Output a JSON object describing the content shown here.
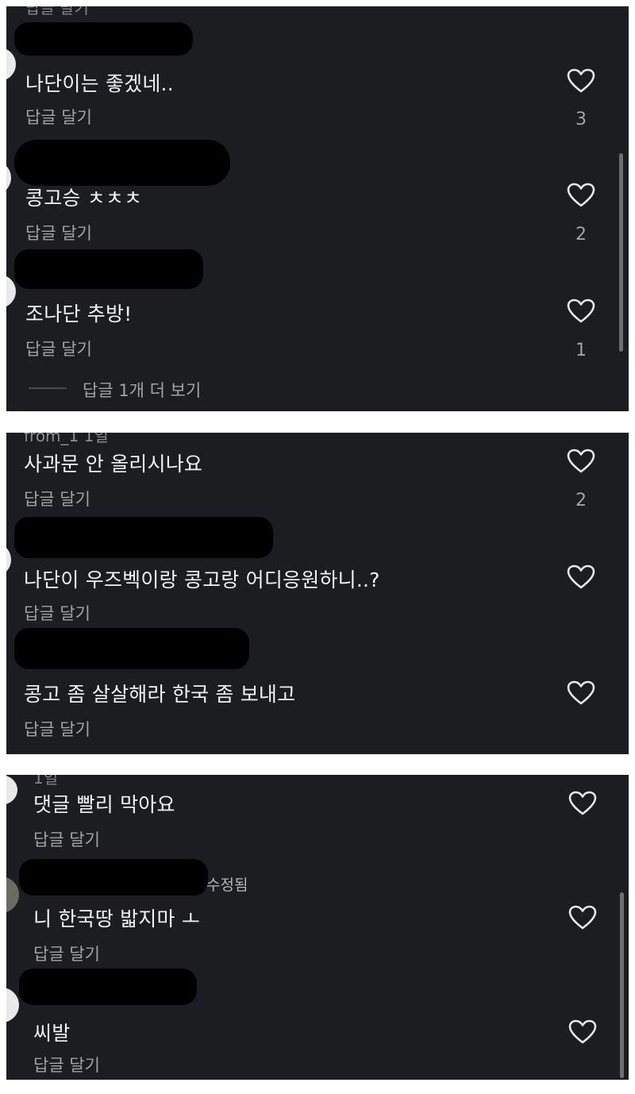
{
  "reply_label": "답글 달기",
  "edited_label": "수정됨",
  "cut_fragments": {
    "p1_top": "답글 달기",
    "p2_top": "from_1 1일",
    "p3_top": "1일"
  },
  "panels": [
    {
      "comments": [
        {
          "text": "나단이는 좋겠네..",
          "likes": "3"
        },
        {
          "text": "콩고승 ㅊㅊㅊ",
          "likes": "2"
        },
        {
          "text": "조나단 추방!",
          "likes": "1"
        }
      ],
      "view_more": "답글 1개 더 보기"
    },
    {
      "comments": [
        {
          "text": "사과문 안 올리시나요",
          "likes": "2"
        },
        {
          "text": "나단이 우즈벡이랑 콩고랑 어디응원하니..?",
          "likes": ""
        },
        {
          "text": "콩고 좀 살살해라 한국 좀 보내고",
          "likes": ""
        }
      ]
    },
    {
      "comments": [
        {
          "text": "댓글 빨리 막아요",
          "likes": ""
        },
        {
          "text": "니 한국땅 밟지마 ㅗ",
          "likes": ""
        },
        {
          "text": "씨발",
          "likes": ""
        }
      ]
    }
  ],
  "colors": {
    "panel_bg": "#1c1d20",
    "text": "#f2f2f2",
    "secondary": "#a3a3a7",
    "redaction": "#000000"
  }
}
